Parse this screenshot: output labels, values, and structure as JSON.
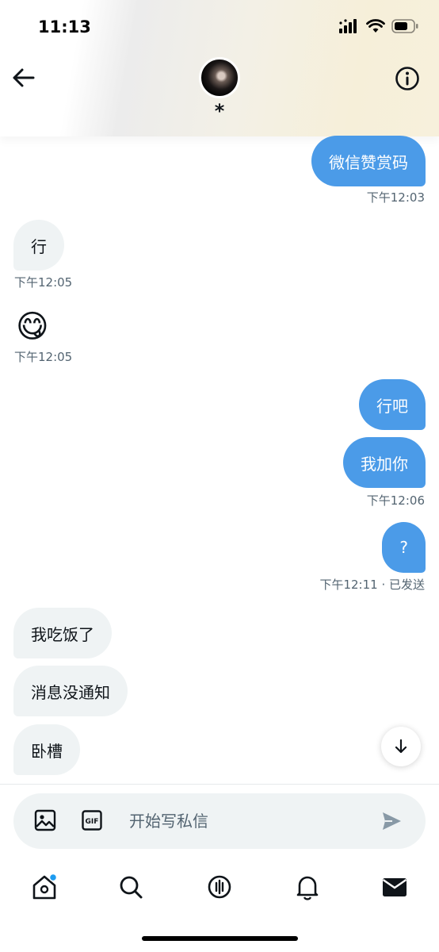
{
  "status_bar": {
    "time": "11:13"
  },
  "conversation": {
    "contact_name": "*"
  },
  "messages": [
    {
      "dir": "out",
      "text": "微信赞赏码",
      "time": "下午12:03"
    },
    {
      "dir": "in",
      "text": "行",
      "time": "下午12:05"
    },
    {
      "dir": "in",
      "text": "😋",
      "time": "下午12:05"
    },
    {
      "dir": "out",
      "text": "行吧"
    },
    {
      "dir": "out",
      "text": "我加你",
      "time": "下午12:06"
    },
    {
      "dir": "out",
      "text": "?",
      "time": "下午12:11 · 已发送"
    },
    {
      "dir": "in",
      "text": "我吃饭了"
    },
    {
      "dir": "in",
      "text": "消息没通知"
    },
    {
      "dir": "in",
      "text": "卧槽"
    }
  ],
  "composer": {
    "placeholder": "开始写私信"
  },
  "icons": {
    "back": "back-arrow-icon",
    "info": "info-icon",
    "scroll_down": "arrow-down-icon",
    "media": "image-icon",
    "gif": "gif-icon",
    "send": "send-icon",
    "tabs": [
      "home-icon",
      "search-icon",
      "spaces-icon",
      "bell-icon",
      "mail-icon"
    ]
  },
  "colors": {
    "outgoing_bubble": "#4b9be8",
    "incoming_bubble": "#eff3f4",
    "notification_dot": "#1d9bf0"
  }
}
